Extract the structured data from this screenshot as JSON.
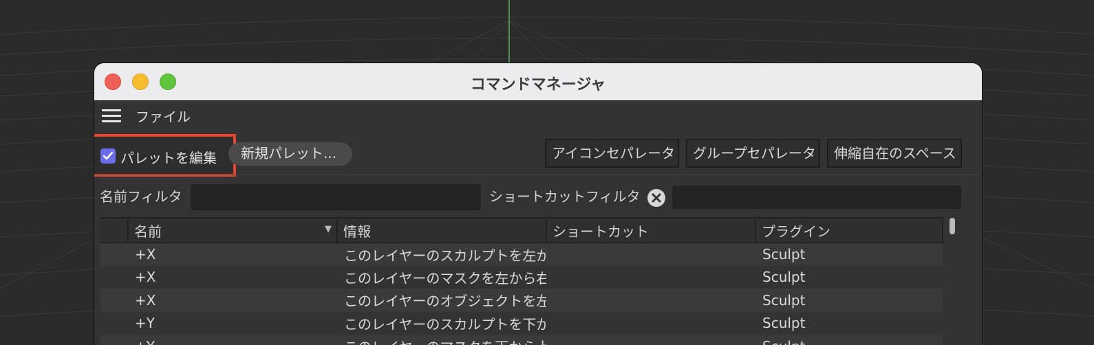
{
  "window": {
    "title": "コマンドマネージャ"
  },
  "menu": {
    "file_label": "ファイル"
  },
  "toolbar": {
    "edit_palette_label": "パレットを編集",
    "edit_palette_checked": true,
    "new_palette_label": "新規パレット...",
    "icon_separator_label": "アイコンセパレータ",
    "group_separator_label": "グループセパレータ",
    "flexible_space_label": "伸縮自在のスペース"
  },
  "filters": {
    "name_filter_label": "名前フィルタ",
    "name_filter_value": "",
    "shortcut_filter_label": "ショートカットフィルタ",
    "shortcut_filter_value": ""
  },
  "table": {
    "columns": [
      "名前",
      "情報",
      "ショートカット",
      "プラグイン"
    ],
    "rows": [
      {
        "name": "+X",
        "info": "このレイヤーのスカルプトを左か",
        "shortcut": "",
        "plugin": "Sculpt"
      },
      {
        "name": "+X",
        "info": "このレイヤーのマスクを左から右",
        "shortcut": "",
        "plugin": "Sculpt"
      },
      {
        "name": "+X",
        "info": "このレイヤーのオブジェクトを左",
        "shortcut": "",
        "plugin": "Sculpt"
      },
      {
        "name": "+Y",
        "info": "このレイヤーのスカルプトを下か",
        "shortcut": "",
        "plugin": "Sculpt"
      },
      {
        "name": "+Y",
        "info": "このレイヤーのマスクを下から上",
        "shortcut": "",
        "plugin": "Sculpt"
      }
    ]
  },
  "colors": {
    "checkbox_accent": "#6b6ee6",
    "highlight_box": "#e8432e",
    "traffic_close": "#ee5f57",
    "traffic_minimize": "#f6be2f",
    "traffic_maximize": "#5fc53c"
  }
}
